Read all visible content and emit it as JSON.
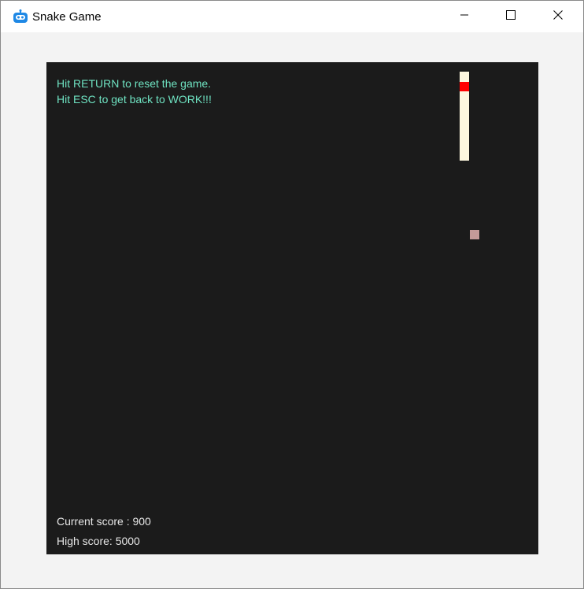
{
  "window": {
    "title": "Snake Game",
    "icon": "robot-app-icon",
    "controls": [
      "minimize-icon",
      "maximize-icon",
      "close-icon"
    ]
  },
  "game": {
    "background_color": "#1b1b1b",
    "instructions": {
      "reset": "Hit RETURN to reset the game.",
      "exit": "Hit ESC to get back to WORK!!!"
    },
    "scores": {
      "current": "Current score : 900",
      "high": "High score: 5000"
    },
    "colors": {
      "instruction_text": "#6fe3c2",
      "score_text": "#e6e6e6",
      "snake_body": "#fdf7df",
      "snake_head": "#ff0000",
      "food": "#c49a98"
    }
  }
}
